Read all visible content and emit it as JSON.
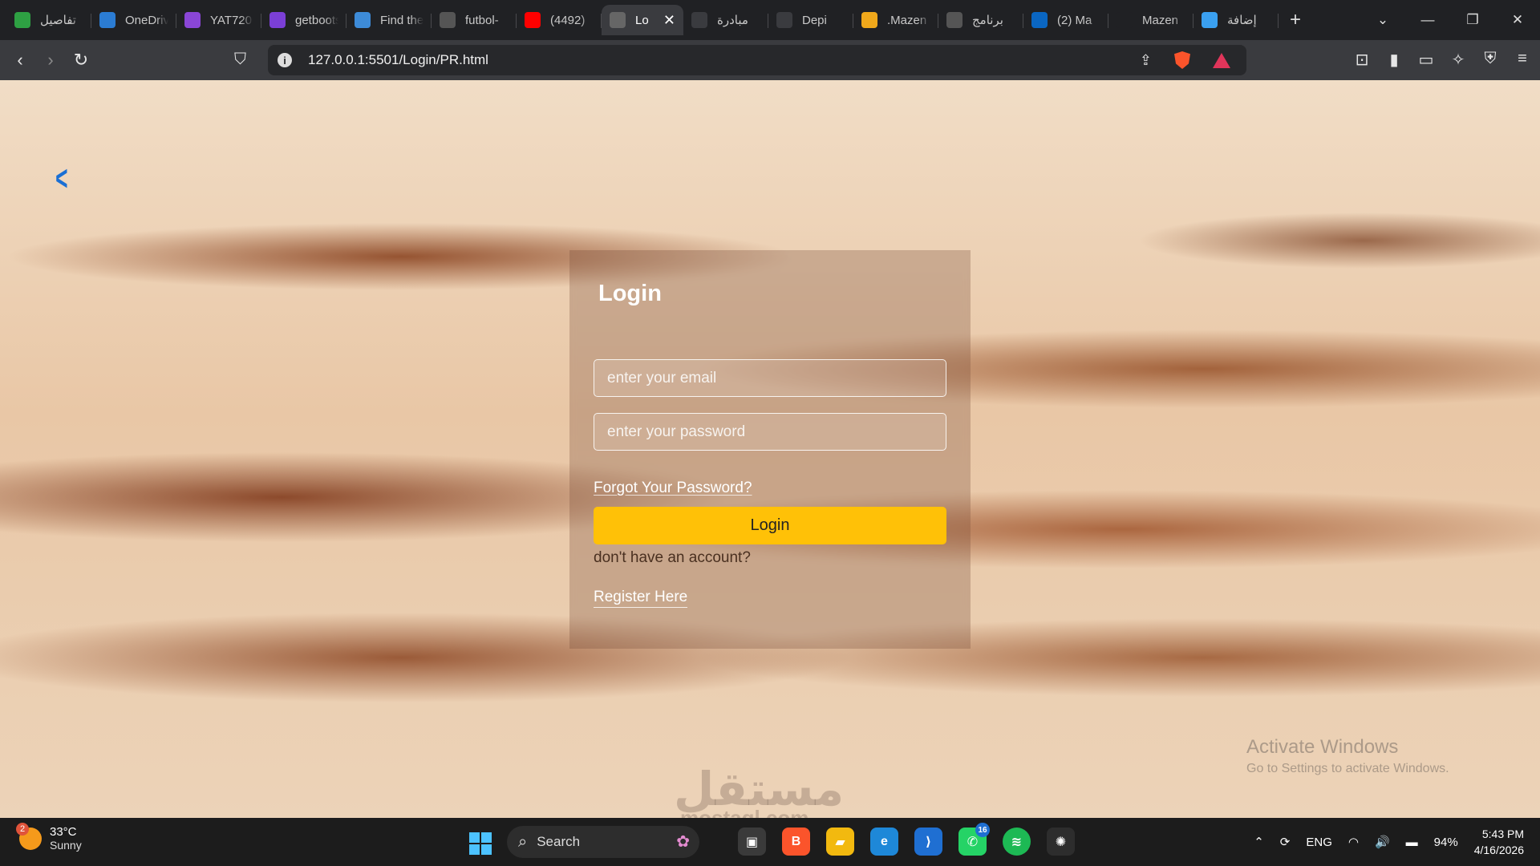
{
  "tabs": [
    {
      "label": "تفاصيل",
      "icon": "image-icon",
      "color": "#2ea043"
    },
    {
      "label": "OneDrive",
      "icon": "onedrive-icon",
      "color": "#2b7cd3"
    },
    {
      "label": "YAT720",
      "icon": "play-icon",
      "color": "#8a46d6"
    },
    {
      "label": "getbootstrap",
      "icon": "bootstrap-icon",
      "color": "#7b3fd6"
    },
    {
      "label": "Find the",
      "icon": "flag-icon",
      "color": "#3d8bd8"
    },
    {
      "label": "futbol-",
      "icon": "globe-icon",
      "color": "#555555"
    },
    {
      "label": "(4492)",
      "icon": "youtube-icon",
      "color": "#ff0000"
    },
    {
      "label": "Lo",
      "icon": "globe-icon",
      "color": "#666666",
      "active": true
    },
    {
      "label": "مبادرة",
      "icon": "depi-icon",
      "color": "#3a3b3f"
    },
    {
      "label": "Depi",
      "icon": "depi-icon",
      "color": "#3a3b3f"
    },
    {
      "label": ".Mazen",
      "icon": "html5-icon",
      "color": "#f0a81b"
    },
    {
      "label": "برنامج",
      "icon": "document-icon",
      "color": "#555555"
    },
    {
      "label": "(2) Ma",
      "icon": "linkedin-icon",
      "color": "#0a66c2"
    },
    {
      "label": "Mazen",
      "icon": "mostaql-icon",
      "color": "#202124"
    },
    {
      "label": "إضافة",
      "icon": "circle-icon",
      "color": "#3aa0f0"
    }
  ],
  "browser": {
    "url": "127.0.0.1:5501/Login/PR.html"
  },
  "login": {
    "title": "Login",
    "email_placeholder": "enter your email",
    "password_placeholder": "enter your password",
    "forgot": "Forgot Your Password?",
    "button": "Login",
    "no_account": "don't have an account?",
    "register": "Register Here",
    "button_color": "#ffc107",
    "back_color": "#1a6fd4"
  },
  "overlay": {
    "activate_title": "Activate Windows",
    "activate_sub": "Go to Settings to activate Windows.",
    "watermark": "مستقل",
    "watermark_sub": "mostaql.com"
  },
  "taskbar": {
    "weather_temp": "33°C",
    "weather_cond": "Sunny",
    "weather_badge": "2",
    "search": "Search",
    "whatsapp_badge": "16",
    "lang": "ENG",
    "battery": "94%",
    "time": "5:43 PM",
    "date": "4/16/2026"
  }
}
